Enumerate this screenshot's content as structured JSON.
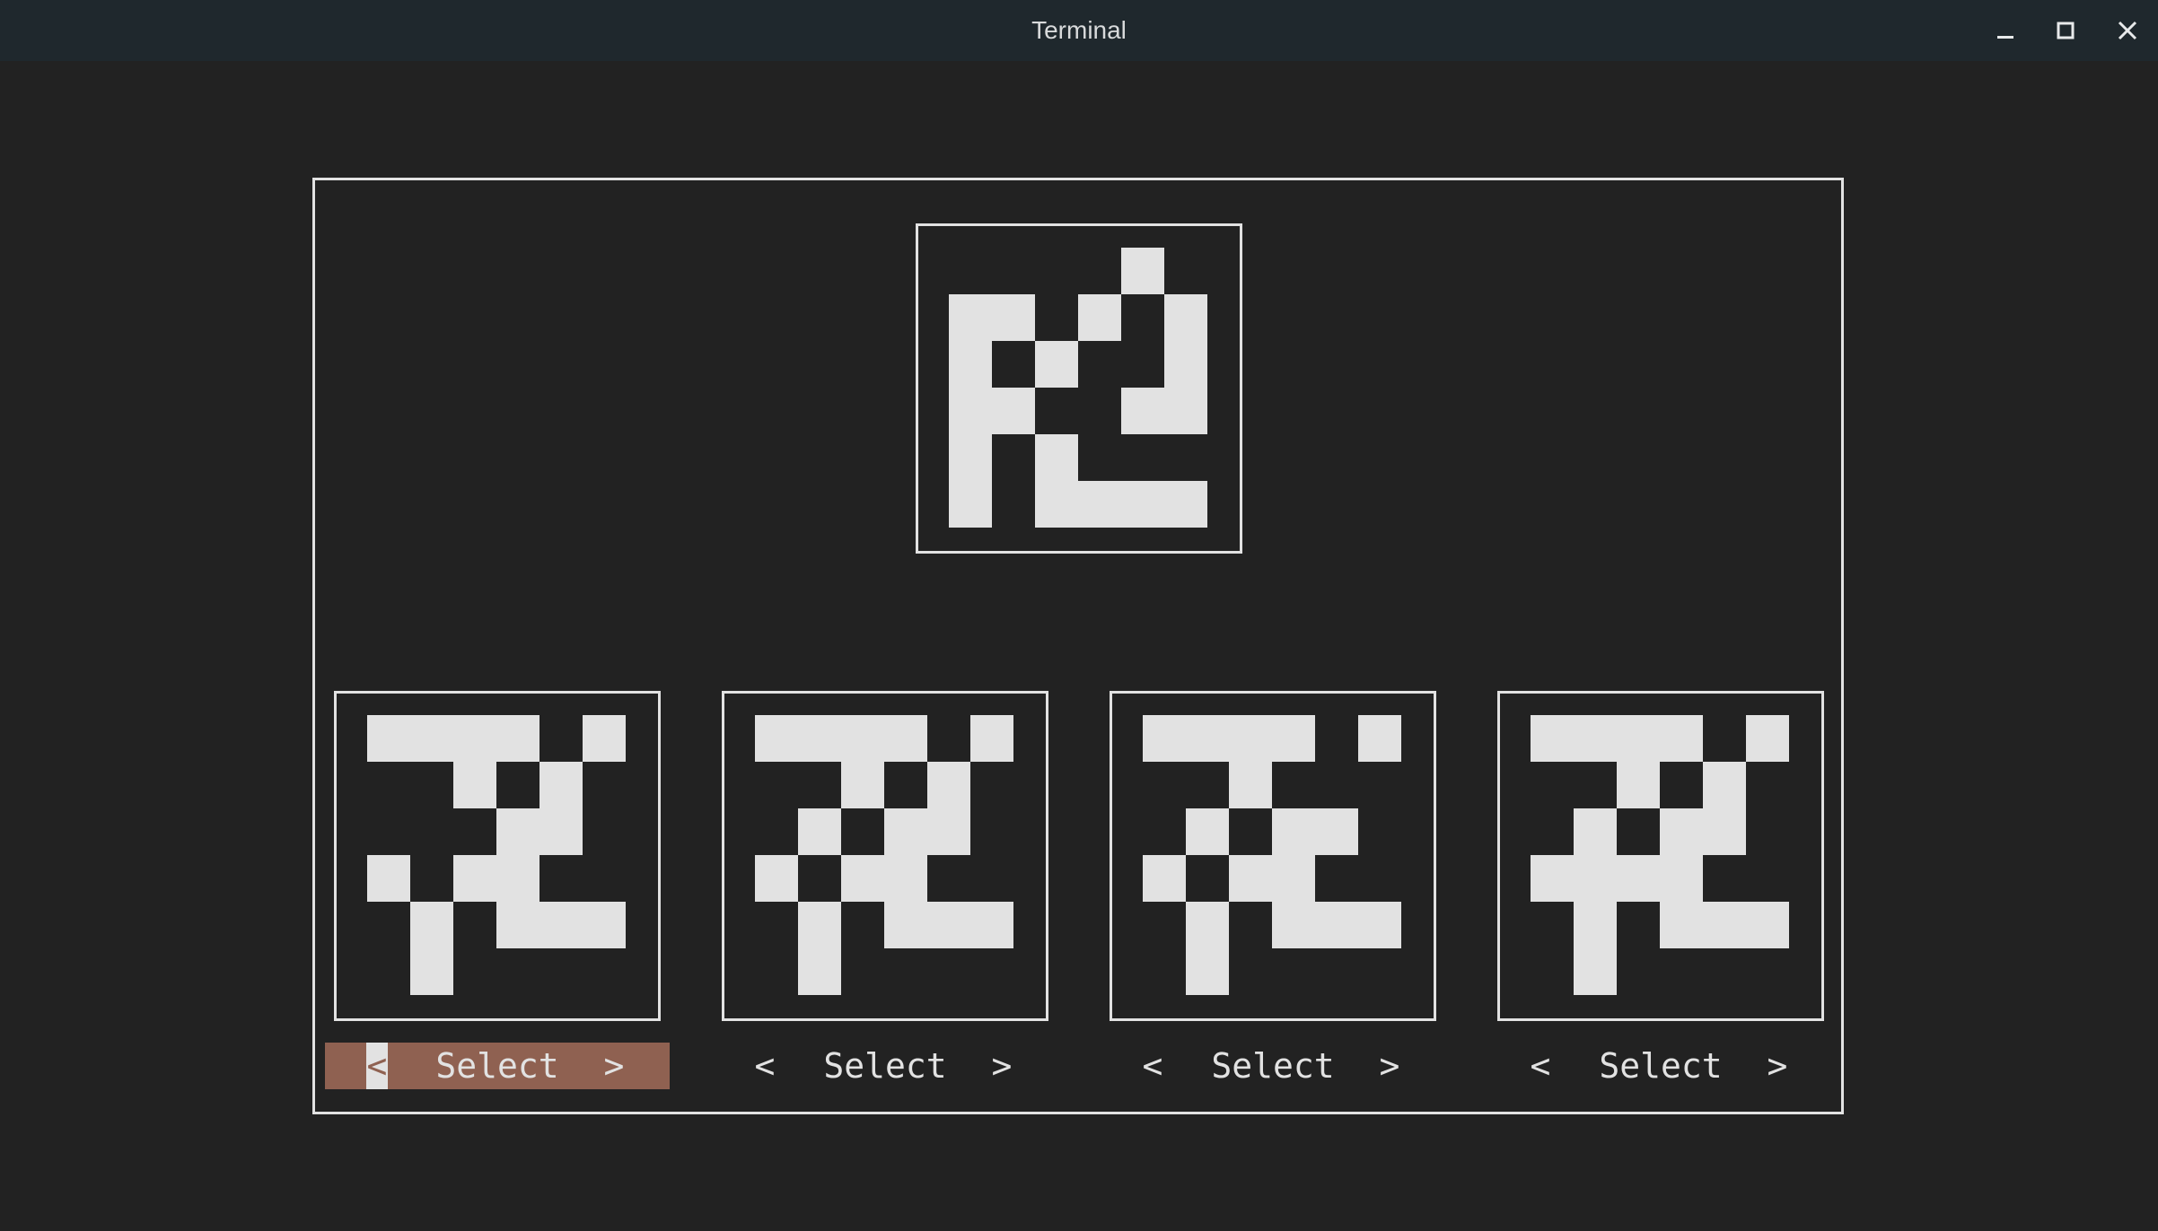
{
  "window": {
    "title": "Terminal"
  },
  "colors": {
    "background": "#222222",
    "titlebar": "#1f282d",
    "foreground": "#e2e2e2",
    "selected": "#8f6151"
  },
  "target": {
    "grid": [
      [
        0,
        0,
        0,
        0,
        1,
        0
      ],
      [
        1,
        1,
        0,
        1,
        0,
        1
      ],
      [
        1,
        0,
        1,
        0,
        0,
        1
      ],
      [
        1,
        1,
        0,
        0,
        1,
        1
      ],
      [
        1,
        0,
        1,
        0,
        0,
        0
      ],
      [
        1,
        0,
        1,
        1,
        1,
        1
      ]
    ]
  },
  "options": [
    {
      "label": "Select",
      "left_arrow": "<",
      "right_arrow": ">",
      "selected": true,
      "grid": [
        [
          1,
          1,
          1,
          1,
          0,
          1
        ],
        [
          0,
          0,
          1,
          0,
          1,
          0
        ],
        [
          0,
          0,
          0,
          1,
          1,
          0
        ],
        [
          1,
          0,
          1,
          1,
          0,
          0
        ],
        [
          0,
          1,
          0,
          1,
          1,
          1
        ],
        [
          0,
          1,
          0,
          0,
          0,
          0
        ]
      ]
    },
    {
      "label": "Select",
      "left_arrow": "<",
      "right_arrow": ">",
      "selected": false,
      "grid": [
        [
          1,
          1,
          1,
          1,
          0,
          1
        ],
        [
          0,
          0,
          1,
          0,
          1,
          0
        ],
        [
          0,
          1,
          0,
          1,
          1,
          0
        ],
        [
          1,
          0,
          1,
          1,
          0,
          0
        ],
        [
          0,
          1,
          0,
          1,
          1,
          1
        ],
        [
          0,
          1,
          0,
          0,
          0,
          0
        ]
      ]
    },
    {
      "label": "Select",
      "left_arrow": "<",
      "right_arrow": ">",
      "selected": false,
      "grid": [
        [
          1,
          1,
          1,
          1,
          0,
          1
        ],
        [
          0,
          0,
          1,
          0,
          0,
          0
        ],
        [
          0,
          1,
          0,
          1,
          1,
          0
        ],
        [
          1,
          0,
          1,
          1,
          0,
          0
        ],
        [
          0,
          1,
          0,
          1,
          1,
          1
        ],
        [
          0,
          1,
          0,
          0,
          0,
          0
        ]
      ]
    },
    {
      "label": "Select",
      "left_arrow": "<",
      "right_arrow": ">",
      "selected": false,
      "grid": [
        [
          1,
          1,
          1,
          1,
          0,
          1
        ],
        [
          0,
          0,
          1,
          0,
          1,
          0
        ],
        [
          0,
          1,
          0,
          1,
          1,
          0
        ],
        [
          1,
          1,
          1,
          1,
          0,
          0
        ],
        [
          0,
          1,
          0,
          1,
          1,
          1
        ],
        [
          0,
          1,
          0,
          0,
          0,
          0
        ]
      ]
    }
  ]
}
